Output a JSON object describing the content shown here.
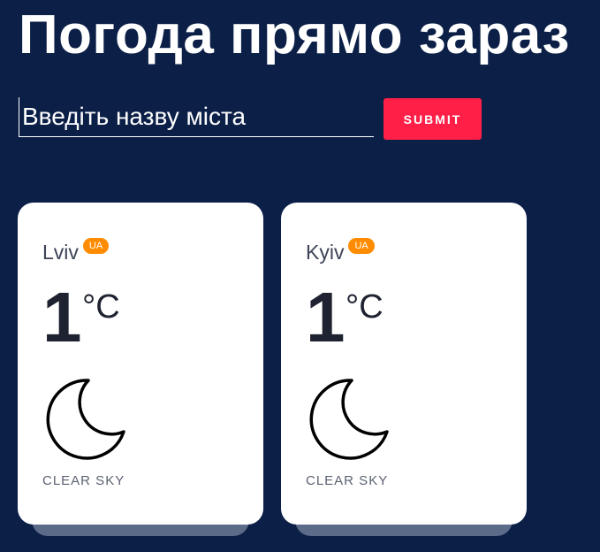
{
  "header": {
    "title": "Погода прямо зараз"
  },
  "search": {
    "placeholder": "Введіть назву міста",
    "submit_label": "SUBMIT"
  },
  "colors": {
    "background": "#0b1f47",
    "submit": "#ff1f47",
    "badge": "#ff8c00",
    "card": "#ffffff"
  },
  "cards": [
    {
      "city": "Lviv",
      "country": "UA",
      "temp": "1",
      "unit": "°C",
      "icon": "moon-icon",
      "description": "CLEAR SKY"
    },
    {
      "city": "Kyiv",
      "country": "UA",
      "temp": "1",
      "unit": "°C",
      "icon": "moon-icon",
      "description": "CLEAR SKY"
    }
  ]
}
